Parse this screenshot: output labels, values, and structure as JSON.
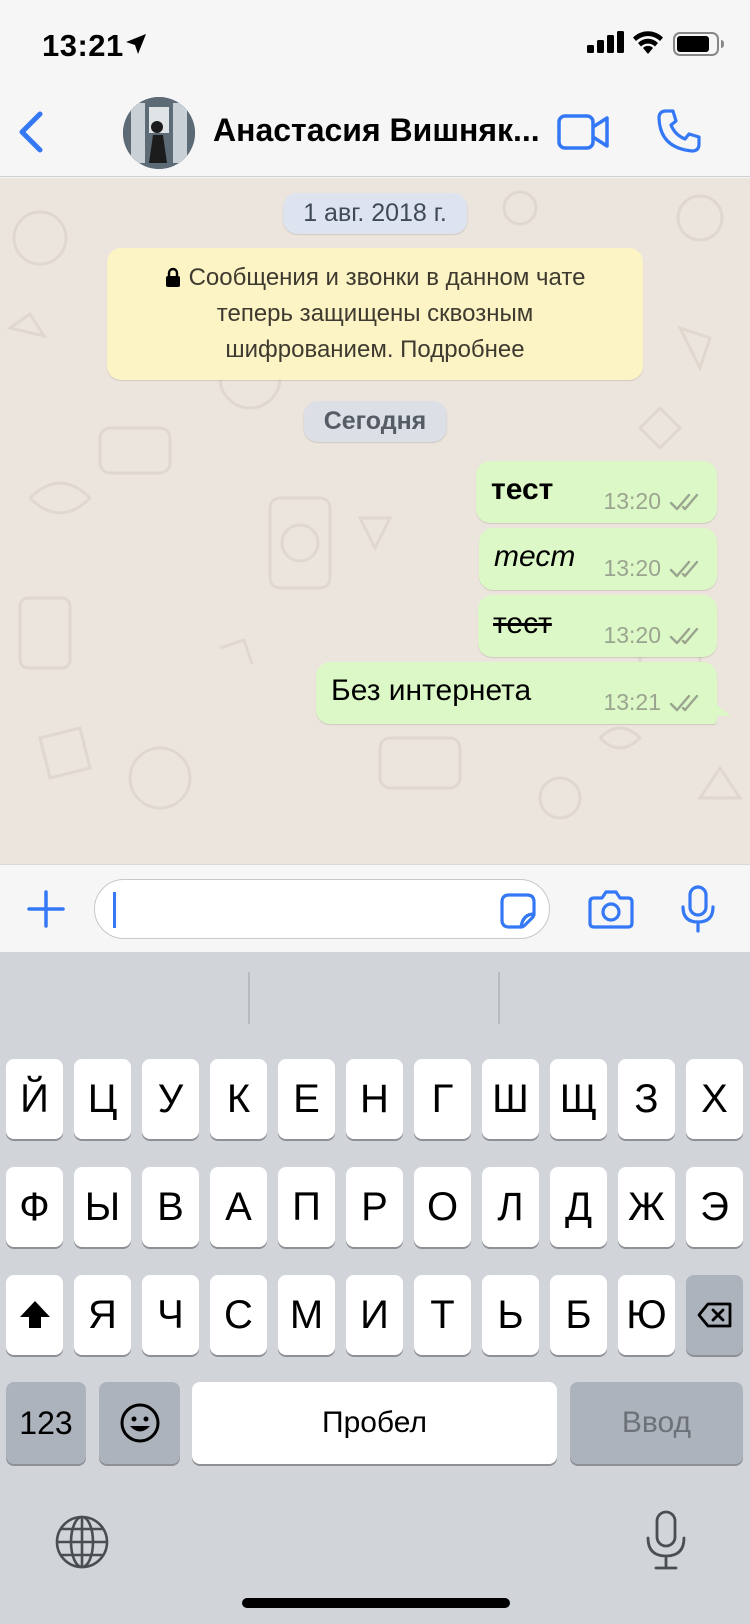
{
  "status_bar": {
    "time": "13:21"
  },
  "header": {
    "contact_name": "Анастасия Вишняк..."
  },
  "chat": {
    "date_label_1": "1 авг. 2018 г.",
    "encryption_notice": [
      "Сообщения и звонки в данном чате",
      "теперь защищены сквозным",
      "шифрованием. Подробнее"
    ],
    "date_label_2": "Сегодня",
    "messages": [
      {
        "text": "тест",
        "time": "13:20",
        "style": "bold"
      },
      {
        "text": "тест",
        "time": "13:20",
        "style": "italic"
      },
      {
        "text": "тест",
        "time": "13:20",
        "style": "strikethrough"
      },
      {
        "text": "Без интернета",
        "time": "13:21",
        "style": "normal"
      }
    ]
  },
  "input_bar": {
    "value": ""
  },
  "keyboard": {
    "row1": [
      "Й",
      "Ц",
      "У",
      "К",
      "Е",
      "Н",
      "Г",
      "Ш",
      "Щ",
      "З",
      "Х"
    ],
    "row2": [
      "Ф",
      "Ы",
      "В",
      "А",
      "П",
      "Р",
      "О",
      "Л",
      "Д",
      "Ж",
      "Э"
    ],
    "row3": [
      "Я",
      "Ч",
      "С",
      "М",
      "И",
      "Т",
      "Ь",
      "Б",
      "Ю"
    ],
    "numbers_label": "123",
    "space_label": "Пробел",
    "return_label": "Ввод"
  },
  "colors": {
    "accent": "#3478f6",
    "outgoing_bubble": "#dcf8c6",
    "notice_bg": "#fcf4c4",
    "chat_bg": "#ece5dd"
  }
}
